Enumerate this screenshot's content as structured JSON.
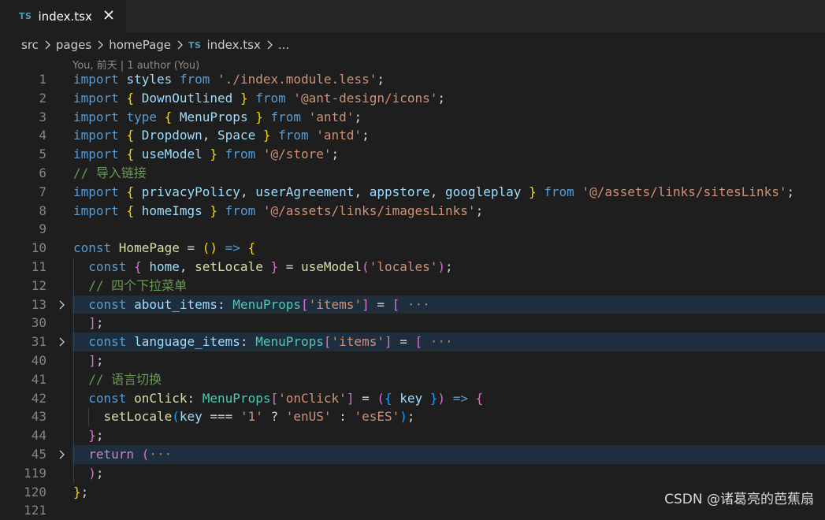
{
  "tab": {
    "lang_badge": "TS",
    "filename": "index.tsx"
  },
  "breadcrumb": [
    "src",
    "pages",
    "homePage",
    "index.tsx",
    "..."
  ],
  "blame": "You, 前天 | 1 author (You)",
  "colors": {
    "keyword": "#569cd6",
    "control": "#c586c0",
    "variable": "#9cdcfe",
    "string": "#ce9178",
    "comment": "#6a9955",
    "type": "#4ec9b0",
    "function": "#dcdcaa",
    "folded_highlight": "#1f2e3c"
  },
  "lines": [
    {
      "num": "1",
      "folded": false,
      "tokens": [
        [
          "import ",
          "kw"
        ],
        [
          "styles ",
          "var"
        ],
        [
          "from ",
          "kw"
        ],
        [
          "'./index.module.less'",
          "str"
        ],
        [
          ";",
          "op"
        ]
      ]
    },
    {
      "num": "2",
      "folded": false,
      "tokens": [
        [
          "import ",
          "kw"
        ],
        [
          "{ ",
          "b1"
        ],
        [
          "DownOutlined ",
          "var"
        ],
        [
          "} ",
          "b1"
        ],
        [
          "from ",
          "kw"
        ],
        [
          "'@ant-design/icons'",
          "str"
        ],
        [
          ";",
          "op"
        ]
      ]
    },
    {
      "num": "3",
      "folded": false,
      "tokens": [
        [
          "import ",
          "kw"
        ],
        [
          "type ",
          "kw"
        ],
        [
          "{ ",
          "b1"
        ],
        [
          "MenuProps ",
          "var"
        ],
        [
          "} ",
          "b1"
        ],
        [
          "from ",
          "kw"
        ],
        [
          "'antd'",
          "str"
        ],
        [
          ";",
          "op"
        ]
      ]
    },
    {
      "num": "4",
      "folded": false,
      "tokens": [
        [
          "import ",
          "kw"
        ],
        [
          "{ ",
          "b1"
        ],
        [
          "Dropdown",
          "var"
        ],
        [
          ", ",
          "op"
        ],
        [
          "Space ",
          "var"
        ],
        [
          "} ",
          "b1"
        ],
        [
          "from ",
          "kw"
        ],
        [
          "'antd'",
          "str"
        ],
        [
          ";",
          "op"
        ]
      ]
    },
    {
      "num": "5",
      "folded": false,
      "tokens": [
        [
          "import ",
          "kw"
        ],
        [
          "{ ",
          "b1"
        ],
        [
          "useModel ",
          "var"
        ],
        [
          "} ",
          "b1"
        ],
        [
          "from ",
          "kw"
        ],
        [
          "'@/store'",
          "str"
        ],
        [
          ";",
          "op"
        ]
      ]
    },
    {
      "num": "6",
      "folded": false,
      "tokens": [
        [
          "// 导入链接",
          "cmt"
        ]
      ]
    },
    {
      "num": "7",
      "folded": false,
      "tokens": [
        [
          "import ",
          "kw"
        ],
        [
          "{ ",
          "b1"
        ],
        [
          "privacyPolicy",
          "var"
        ],
        [
          ", ",
          "op"
        ],
        [
          "userAgreement",
          "var"
        ],
        [
          ", ",
          "op"
        ],
        [
          "appstore",
          "var"
        ],
        [
          ", ",
          "op"
        ],
        [
          "googleplay ",
          "var"
        ],
        [
          "} ",
          "b1"
        ],
        [
          "from ",
          "kw"
        ],
        [
          "'@/assets/links/sitesLinks'",
          "str"
        ],
        [
          ";",
          "op"
        ]
      ]
    },
    {
      "num": "8",
      "folded": false,
      "tokens": [
        [
          "import ",
          "kw"
        ],
        [
          "{ ",
          "b1"
        ],
        [
          "homeImgs ",
          "var"
        ],
        [
          "} ",
          "b1"
        ],
        [
          "from ",
          "kw"
        ],
        [
          "'@/assets/links/imagesLinks'",
          "str"
        ],
        [
          ";",
          "op"
        ]
      ]
    },
    {
      "num": "9",
      "folded": false,
      "tokens": []
    },
    {
      "num": "10",
      "folded": false,
      "tokens": [
        [
          "const ",
          "kw"
        ],
        [
          "HomePage ",
          "fn"
        ],
        [
          "= ",
          "op"
        ],
        [
          "() ",
          "b1"
        ],
        [
          "=> ",
          "kw"
        ],
        [
          "{",
          "b1"
        ]
      ]
    },
    {
      "num": "11",
      "folded": false,
      "tokens": [
        [
          "  ",
          "op"
        ],
        [
          "const ",
          "kw"
        ],
        [
          "{ ",
          "b2"
        ],
        [
          "home",
          "var"
        ],
        [
          ", ",
          "op"
        ],
        [
          "setLocale ",
          "fn"
        ],
        [
          "} ",
          "b2"
        ],
        [
          "= ",
          "op"
        ],
        [
          "useModel",
          "fn"
        ],
        [
          "(",
          "b2"
        ],
        [
          "'locales'",
          "str"
        ],
        [
          ")",
          "b2"
        ],
        [
          ";",
          "op"
        ]
      ]
    },
    {
      "num": "12",
      "folded": false,
      "tokens": [
        [
          "  ",
          "op"
        ],
        [
          "// 四个下拉菜单",
          "cmt"
        ]
      ]
    },
    {
      "num": "13",
      "folded": true,
      "tokens": [
        [
          "  ",
          "op"
        ],
        [
          "const ",
          "kw"
        ],
        [
          "about_items",
          "var"
        ],
        [
          ": ",
          "op"
        ],
        [
          "MenuProps",
          "type"
        ],
        [
          "[",
          "b2"
        ],
        [
          "'items'",
          "str"
        ],
        [
          "] ",
          "b2"
        ],
        [
          "= ",
          "op"
        ],
        [
          "[ ",
          "b2"
        ],
        [
          "···",
          "ell"
        ]
      ]
    },
    {
      "num": "30",
      "folded": false,
      "tokens": [
        [
          "  ",
          "op"
        ],
        [
          "]",
          "b2"
        ],
        [
          ";",
          "op"
        ]
      ]
    },
    {
      "num": "31",
      "folded": true,
      "tokens": [
        [
          "  ",
          "op"
        ],
        [
          "const ",
          "kw"
        ],
        [
          "language_items",
          "var"
        ],
        [
          ": ",
          "op"
        ],
        [
          "MenuProps",
          "type"
        ],
        [
          "[",
          "b2"
        ],
        [
          "'items'",
          "str"
        ],
        [
          "] ",
          "b2"
        ],
        [
          "= ",
          "op"
        ],
        [
          "[ ",
          "b2"
        ],
        [
          "···",
          "ell"
        ]
      ]
    },
    {
      "num": "40",
      "folded": false,
      "tokens": [
        [
          "  ",
          "op"
        ],
        [
          "]",
          "b2"
        ],
        [
          ";",
          "op"
        ]
      ]
    },
    {
      "num": "41",
      "folded": false,
      "tokens": [
        [
          "  ",
          "op"
        ],
        [
          "// 语言切换",
          "cmt"
        ]
      ]
    },
    {
      "num": "42",
      "folded": false,
      "tokens": [
        [
          "  ",
          "op"
        ],
        [
          "const ",
          "kw"
        ],
        [
          "onClick",
          "fn"
        ],
        [
          ": ",
          "op"
        ],
        [
          "MenuProps",
          "type"
        ],
        [
          "[",
          "b2"
        ],
        [
          "'onClick'",
          "str"
        ],
        [
          "] ",
          "b2"
        ],
        [
          "= ",
          "op"
        ],
        [
          "(",
          "b2"
        ],
        [
          "{ ",
          "b3"
        ],
        [
          "key ",
          "var"
        ],
        [
          "}",
          "b3"
        ],
        [
          ") ",
          "b2"
        ],
        [
          "=> ",
          "kw"
        ],
        [
          "{",
          "b2"
        ]
      ]
    },
    {
      "num": "43",
      "folded": false,
      "tokens": [
        [
          "    ",
          "op"
        ],
        [
          "setLocale",
          "fn"
        ],
        [
          "(",
          "b3"
        ],
        [
          "key ",
          "var"
        ],
        [
          "=== ",
          "op"
        ],
        [
          "'1' ",
          "str"
        ],
        [
          "? ",
          "op"
        ],
        [
          "'enUS' ",
          "str"
        ],
        [
          ": ",
          "op"
        ],
        [
          "'esES'",
          "str"
        ],
        [
          ")",
          "b3"
        ],
        [
          ";",
          "op"
        ]
      ]
    },
    {
      "num": "44",
      "folded": false,
      "tokens": [
        [
          "  ",
          "op"
        ],
        [
          "}",
          "b2"
        ],
        [
          ";",
          "op"
        ]
      ]
    },
    {
      "num": "45",
      "folded": true,
      "tokens": [
        [
          "  ",
          "op"
        ],
        [
          "return ",
          "ctl"
        ],
        [
          "(",
          "b2"
        ],
        [
          "···",
          "ell"
        ]
      ]
    },
    {
      "num": "119",
      "folded": false,
      "tokens": [
        [
          "  ",
          "op"
        ],
        [
          ")",
          "b2"
        ],
        [
          ";",
          "op"
        ]
      ]
    },
    {
      "num": "120",
      "folded": false,
      "tokens": [
        [
          "}",
          "b1"
        ],
        [
          ";",
          "op"
        ]
      ]
    },
    {
      "num": "121",
      "folded": false,
      "tokens": []
    }
  ],
  "watermark": "CSDN @诸葛亮的芭蕉扇"
}
